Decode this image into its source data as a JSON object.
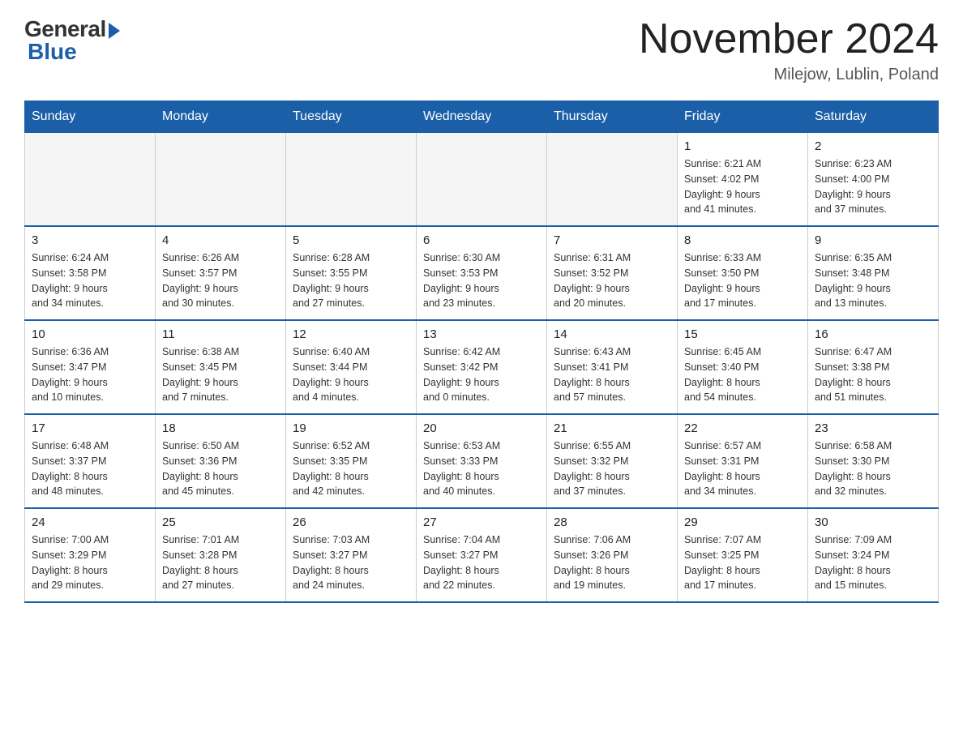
{
  "header": {
    "logo_general": "General",
    "logo_blue": "Blue",
    "month_title": "November 2024",
    "location": "Milejow, Lublin, Poland"
  },
  "days_of_week": [
    "Sunday",
    "Monday",
    "Tuesday",
    "Wednesday",
    "Thursday",
    "Friday",
    "Saturday"
  ],
  "weeks": [
    [
      {
        "day": "",
        "info": ""
      },
      {
        "day": "",
        "info": ""
      },
      {
        "day": "",
        "info": ""
      },
      {
        "day": "",
        "info": ""
      },
      {
        "day": "",
        "info": ""
      },
      {
        "day": "1",
        "info": "Sunrise: 6:21 AM\nSunset: 4:02 PM\nDaylight: 9 hours\nand 41 minutes."
      },
      {
        "day": "2",
        "info": "Sunrise: 6:23 AM\nSunset: 4:00 PM\nDaylight: 9 hours\nand 37 minutes."
      }
    ],
    [
      {
        "day": "3",
        "info": "Sunrise: 6:24 AM\nSunset: 3:58 PM\nDaylight: 9 hours\nand 34 minutes."
      },
      {
        "day": "4",
        "info": "Sunrise: 6:26 AM\nSunset: 3:57 PM\nDaylight: 9 hours\nand 30 minutes."
      },
      {
        "day": "5",
        "info": "Sunrise: 6:28 AM\nSunset: 3:55 PM\nDaylight: 9 hours\nand 27 minutes."
      },
      {
        "day": "6",
        "info": "Sunrise: 6:30 AM\nSunset: 3:53 PM\nDaylight: 9 hours\nand 23 minutes."
      },
      {
        "day": "7",
        "info": "Sunrise: 6:31 AM\nSunset: 3:52 PM\nDaylight: 9 hours\nand 20 minutes."
      },
      {
        "day": "8",
        "info": "Sunrise: 6:33 AM\nSunset: 3:50 PM\nDaylight: 9 hours\nand 17 minutes."
      },
      {
        "day": "9",
        "info": "Sunrise: 6:35 AM\nSunset: 3:48 PM\nDaylight: 9 hours\nand 13 minutes."
      }
    ],
    [
      {
        "day": "10",
        "info": "Sunrise: 6:36 AM\nSunset: 3:47 PM\nDaylight: 9 hours\nand 10 minutes."
      },
      {
        "day": "11",
        "info": "Sunrise: 6:38 AM\nSunset: 3:45 PM\nDaylight: 9 hours\nand 7 minutes."
      },
      {
        "day": "12",
        "info": "Sunrise: 6:40 AM\nSunset: 3:44 PM\nDaylight: 9 hours\nand 4 minutes."
      },
      {
        "day": "13",
        "info": "Sunrise: 6:42 AM\nSunset: 3:42 PM\nDaylight: 9 hours\nand 0 minutes."
      },
      {
        "day": "14",
        "info": "Sunrise: 6:43 AM\nSunset: 3:41 PM\nDaylight: 8 hours\nand 57 minutes."
      },
      {
        "day": "15",
        "info": "Sunrise: 6:45 AM\nSunset: 3:40 PM\nDaylight: 8 hours\nand 54 minutes."
      },
      {
        "day": "16",
        "info": "Sunrise: 6:47 AM\nSunset: 3:38 PM\nDaylight: 8 hours\nand 51 minutes."
      }
    ],
    [
      {
        "day": "17",
        "info": "Sunrise: 6:48 AM\nSunset: 3:37 PM\nDaylight: 8 hours\nand 48 minutes."
      },
      {
        "day": "18",
        "info": "Sunrise: 6:50 AM\nSunset: 3:36 PM\nDaylight: 8 hours\nand 45 minutes."
      },
      {
        "day": "19",
        "info": "Sunrise: 6:52 AM\nSunset: 3:35 PM\nDaylight: 8 hours\nand 42 minutes."
      },
      {
        "day": "20",
        "info": "Sunrise: 6:53 AM\nSunset: 3:33 PM\nDaylight: 8 hours\nand 40 minutes."
      },
      {
        "day": "21",
        "info": "Sunrise: 6:55 AM\nSunset: 3:32 PM\nDaylight: 8 hours\nand 37 minutes."
      },
      {
        "day": "22",
        "info": "Sunrise: 6:57 AM\nSunset: 3:31 PM\nDaylight: 8 hours\nand 34 minutes."
      },
      {
        "day": "23",
        "info": "Sunrise: 6:58 AM\nSunset: 3:30 PM\nDaylight: 8 hours\nand 32 minutes."
      }
    ],
    [
      {
        "day": "24",
        "info": "Sunrise: 7:00 AM\nSunset: 3:29 PM\nDaylight: 8 hours\nand 29 minutes."
      },
      {
        "day": "25",
        "info": "Sunrise: 7:01 AM\nSunset: 3:28 PM\nDaylight: 8 hours\nand 27 minutes."
      },
      {
        "day": "26",
        "info": "Sunrise: 7:03 AM\nSunset: 3:27 PM\nDaylight: 8 hours\nand 24 minutes."
      },
      {
        "day": "27",
        "info": "Sunrise: 7:04 AM\nSunset: 3:27 PM\nDaylight: 8 hours\nand 22 minutes."
      },
      {
        "day": "28",
        "info": "Sunrise: 7:06 AM\nSunset: 3:26 PM\nDaylight: 8 hours\nand 19 minutes."
      },
      {
        "day": "29",
        "info": "Sunrise: 7:07 AM\nSunset: 3:25 PM\nDaylight: 8 hours\nand 17 minutes."
      },
      {
        "day": "30",
        "info": "Sunrise: 7:09 AM\nSunset: 3:24 PM\nDaylight: 8 hours\nand 15 minutes."
      }
    ]
  ]
}
